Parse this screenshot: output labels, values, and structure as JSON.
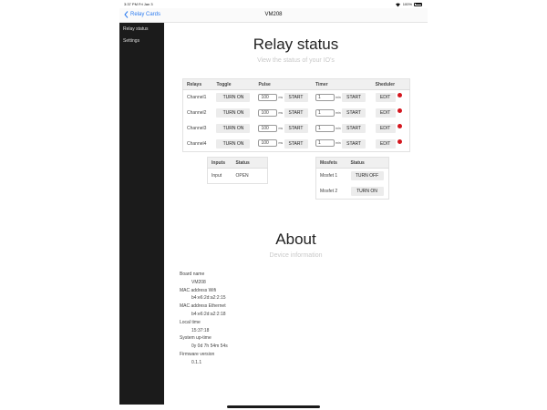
{
  "status_bar": {
    "time": "3:37 PM   Fri Jan 3",
    "battery": "100%"
  },
  "nav": {
    "back_label": "Relay Cards",
    "title": "VM208"
  },
  "sidebar": {
    "items": [
      {
        "label": "Relay status"
      },
      {
        "label": "Settings"
      }
    ]
  },
  "relay_status": {
    "title": "Relay status",
    "subtitle": "View the status of your IO's",
    "headers": [
      "Relays",
      "Toggle",
      "Pulse",
      "Timer",
      "Sheduler"
    ],
    "pulse_unit": "ms",
    "timer_unit": "min",
    "rows": [
      {
        "name": "Channel1",
        "toggle": "TURN ON",
        "pulse": "100",
        "pulse_btn": "START",
        "timer": "1",
        "timer_btn": "START",
        "sched_btn": "EDIT"
      },
      {
        "name": "Channel2",
        "toggle": "TURN ON",
        "pulse": "100",
        "pulse_btn": "START",
        "timer": "1",
        "timer_btn": "START",
        "sched_btn": "EDIT"
      },
      {
        "name": "Channel3",
        "toggle": "TURN ON",
        "pulse": "100",
        "pulse_btn": "START",
        "timer": "1",
        "timer_btn": "START",
        "sched_btn": "EDIT"
      },
      {
        "name": "Channel4",
        "toggle": "TURN ON",
        "pulse": "100",
        "pulse_btn": "START",
        "timer": "1",
        "timer_btn": "START",
        "sched_btn": "EDIT"
      }
    ]
  },
  "inputs": {
    "headers": [
      "Inputs",
      "Status"
    ],
    "rows": [
      {
        "name": "Input",
        "status": "OPEN"
      }
    ]
  },
  "mosfets": {
    "headers": [
      "Mosfets",
      "Status"
    ],
    "rows": [
      {
        "name": "Mosfet 1",
        "button": "TURN OFF"
      },
      {
        "name": "Mosfet 2",
        "button": "TURN ON"
      }
    ]
  },
  "about": {
    "title": "About",
    "subtitle": "Device information",
    "board_name_label": "Board name",
    "board_name": "VM208",
    "mac_wifi_label": "MAC address Wifi",
    "mac_wifi": "b4:e6:2d:a2:2:15",
    "mac_eth_label": "MAC address Ethernet",
    "mac_eth": "b4:e6:2d:a2:2:18",
    "local_time_label": "Local time",
    "local_time": "15:37:18",
    "uptime_label": "System up-time",
    "uptime": "0y 0d 7h 54m 54s",
    "firmware_label": "Firmware version",
    "firmware": "0.1.1"
  },
  "colors": {
    "accent": "#2b7bf0",
    "status_dot": "#d4161e",
    "sidebar_bg": "#1b1b1b"
  }
}
